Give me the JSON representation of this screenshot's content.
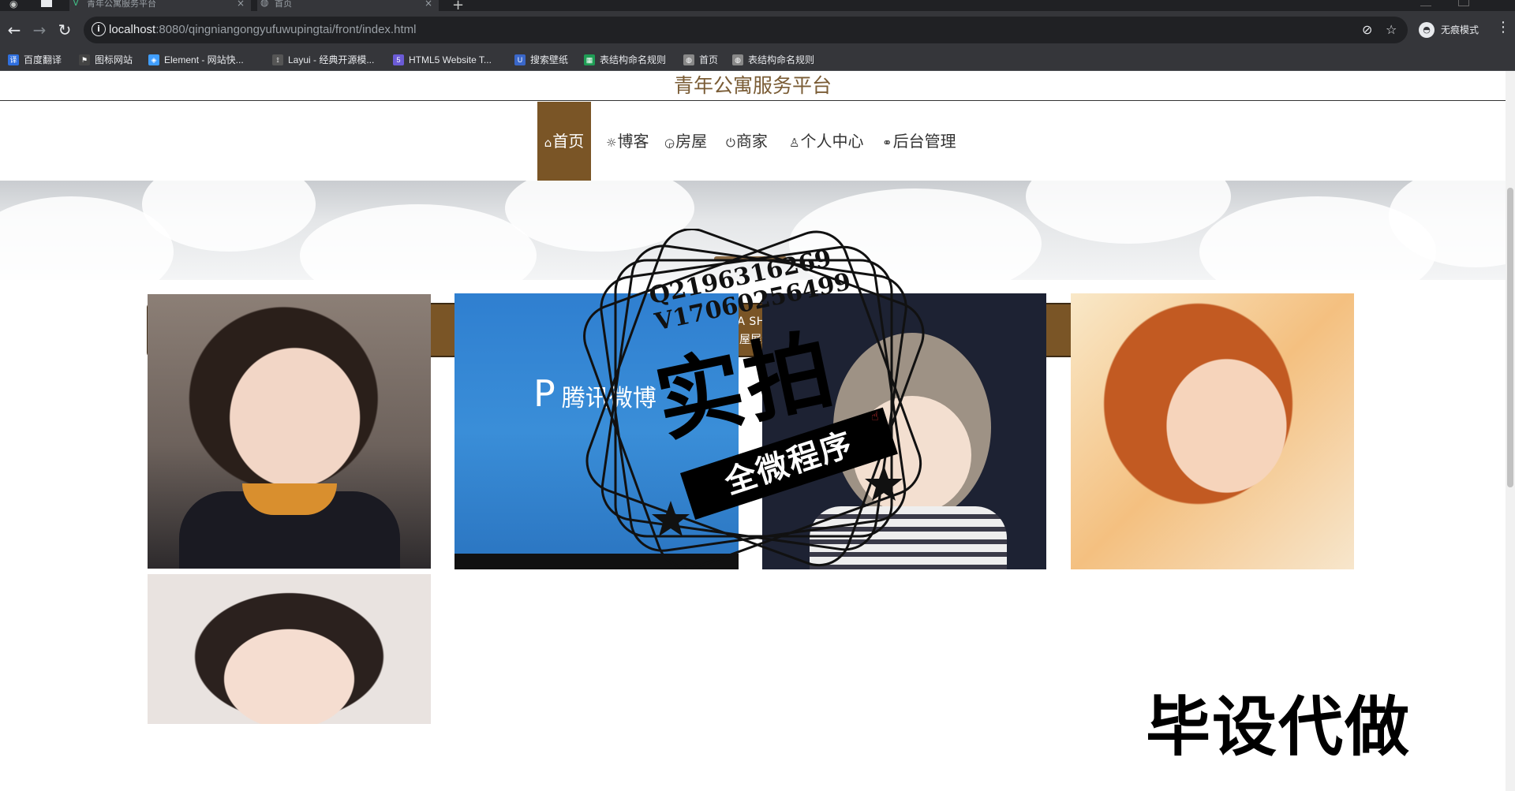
{
  "browser": {
    "tabs": [
      {
        "title": "青年公寓服务平台",
        "active": false
      },
      {
        "title": "首页",
        "active": true
      }
    ],
    "new_tab_label": "+",
    "url": {
      "host": "localhost",
      "rest": ":8080/qingniangongyufuwupingtai/front/index.html"
    },
    "incognito_label": "无痕模式",
    "bookmarks": [
      {
        "label": "百度翻译",
        "icon": "translate-icon",
        "color": "#2f6fde"
      },
      {
        "label": "图标网站",
        "icon": "flag-icon",
        "color": "#444"
      },
      {
        "label": "Element - 网站快...",
        "icon": "element-icon",
        "color": "#409eff"
      },
      {
        "label": "Layui - 经典开源模...",
        "icon": "layui-icon",
        "color": "#555"
      },
      {
        "label": "HTML5 Website T...",
        "icon": "html5-icon",
        "color": "#6b5bd6"
      },
      {
        "label": "搜索壁纸",
        "icon": "wallpaper-icon",
        "color": "#3a67c9"
      },
      {
        "label": "表结构命名规则",
        "icon": "sheet-icon",
        "color": "#1f9d55"
      },
      {
        "label": "首页",
        "icon": "globe-icon",
        "color": "#888"
      },
      {
        "label": "表结构命名规则",
        "icon": "globe-icon",
        "color": "#888"
      }
    ]
  },
  "site": {
    "title": "青年公寓服务平台",
    "nav": [
      {
        "label": "首页",
        "icon": "home-icon",
        "glyph": "⌂",
        "active": true
      },
      {
        "label": "博客",
        "icon": "sun-icon",
        "glyph": "☼",
        "active": false
      },
      {
        "label": "房屋",
        "icon": "gauge-icon",
        "glyph": "◶",
        "active": false
      },
      {
        "label": "商家",
        "icon": "power-icon",
        "glyph": "⏻",
        "active": false
      },
      {
        "label": "个人中心",
        "icon": "user-icon",
        "glyph": "♙",
        "active": false
      },
      {
        "label": "后台管理",
        "icon": "link-icon",
        "glyph": "⚭",
        "active": false
      }
    ],
    "section": {
      "title_en": "DATA SHOW",
      "title_cn": "房屋展示"
    },
    "photos": [
      "photo-1",
      "photo-2",
      "photo-3",
      "photo-4",
      "photo-5"
    ],
    "photo_text": {
      "weibo": "腾讯微博"
    }
  },
  "overlay": {
    "contact_q": "Q2196316269",
    "contact_v": "V17060256499",
    "stamp_main": "实拍",
    "stamp_band": "全微程序",
    "corner_text": "毕设代做"
  },
  "colors": {
    "accent_brown": "#7a5526",
    "title_brown": "#7a5c35",
    "chrome_dark": "#35363a"
  }
}
